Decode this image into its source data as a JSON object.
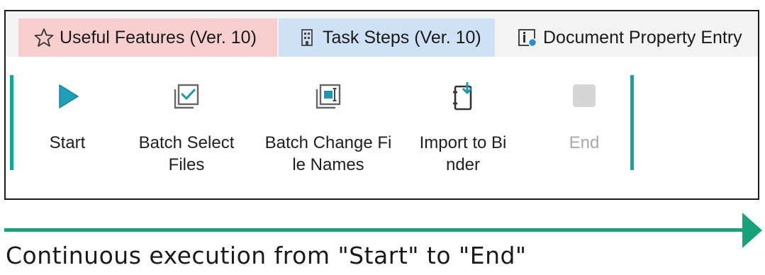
{
  "tabs": [
    {
      "label": "Useful Features (Ver. 10)",
      "icon": "star-icon",
      "color": "#f7cfcf"
    },
    {
      "label": "Task Steps (Ver. 10)",
      "icon": "building-icon",
      "color": "#cfe1f5"
    },
    {
      "label": "Document Property Entry",
      "icon": "info-icon"
    }
  ],
  "ribbon": {
    "buttons": [
      {
        "label": "Start",
        "icon": "play-icon",
        "enabled": true
      },
      {
        "label": "Batch Select\nFiles",
        "icon": "checkbox-stack-icon",
        "enabled": true
      },
      {
        "label": "Batch Change Fi\nle Names",
        "icon": "rename-icon",
        "enabled": true
      },
      {
        "label": "Import to Bi\nnder",
        "icon": "binder-import-icon",
        "enabled": true
      },
      {
        "label": "End",
        "icon": "stop-icon",
        "enabled": false
      }
    ],
    "separator_color": "#13a5a0"
  },
  "caption": "Continuous execution from \"Start\" to \"End\"",
  "arrow_color": "#17a37a"
}
